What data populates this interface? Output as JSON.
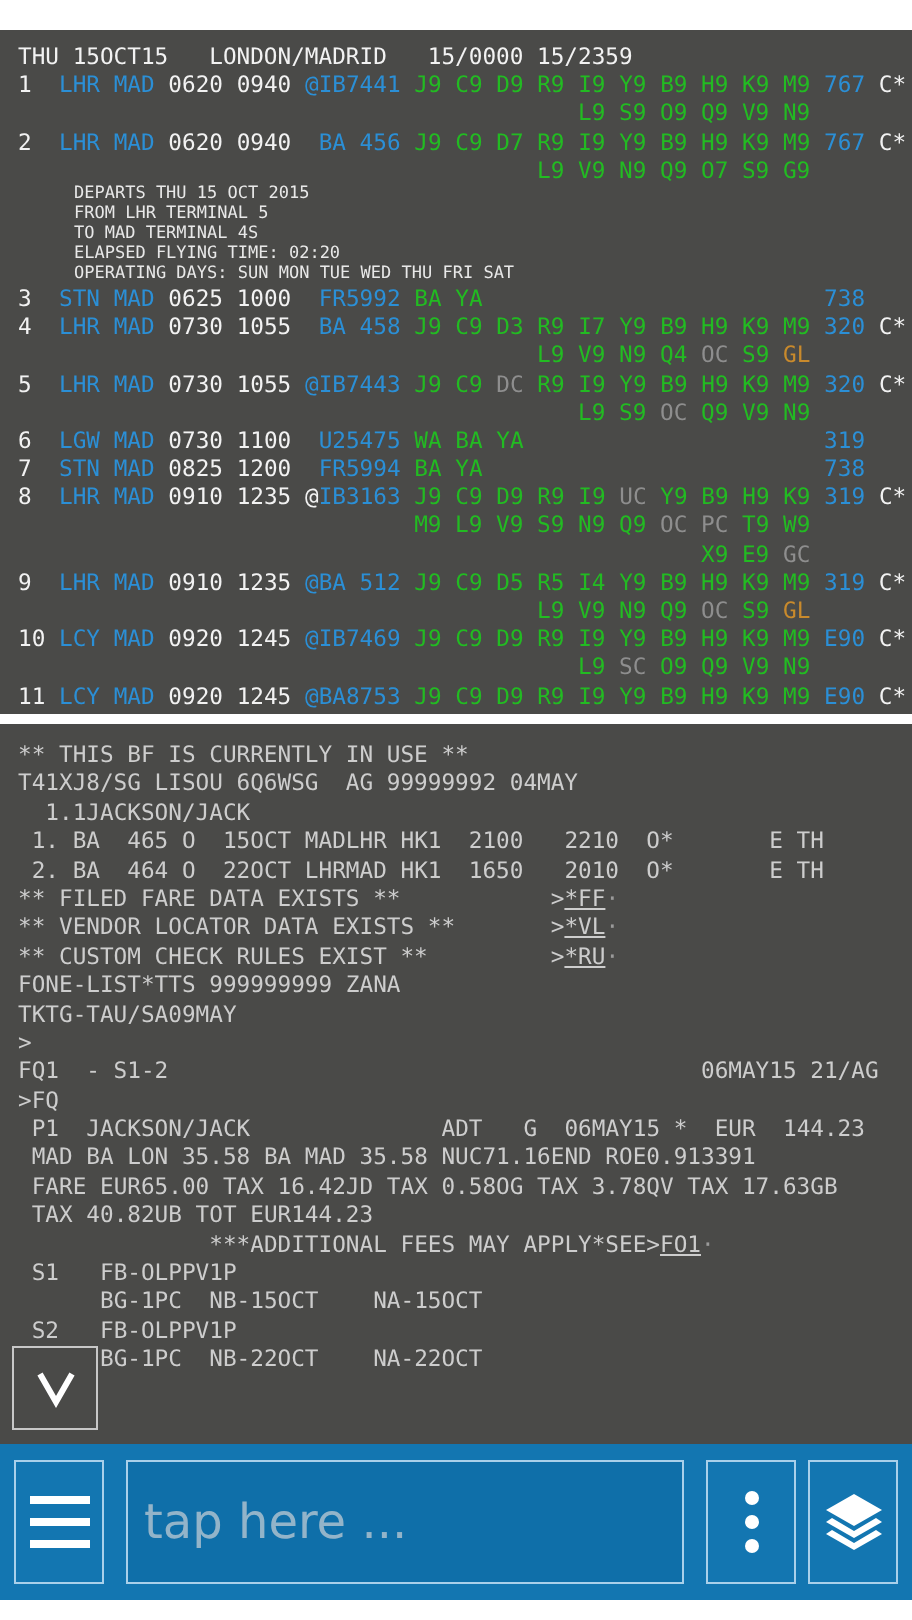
{
  "availability": {
    "header": "THU 15OCT15   LONDON/MADRID   15/0000 15/2359",
    "lines": [
      {
        "kind": "row",
        "segments": [
          {
            "text": "1",
            "kind": "plain"
          },
          {
            "text": "  LHR MAD",
            "kind": "route"
          },
          {
            "text": " 0620 0940",
            "kind": "plain"
          },
          {
            "text": " @IB7441",
            "kind": "route"
          },
          {
            "text": " J9 C9 D9 R9 I9 Y9 B9 H9 K9 M9",
            "kind": "open"
          },
          {
            "text": " 767",
            "kind": "route"
          },
          {
            "text": " C*",
            "kind": "plain"
          }
        ]
      },
      {
        "kind": "row",
        "segments": [
          {
            "text": "                                         L9 S9 O9 Q9 V9 N9",
            "kind": "open"
          }
        ]
      },
      {
        "kind": "row",
        "segments": [
          {
            "text": "2",
            "kind": "plain"
          },
          {
            "text": "  LHR MAD",
            "kind": "route"
          },
          {
            "text": " 0620 0940",
            "kind": "plain"
          },
          {
            "text": "  BA 456",
            "kind": "route"
          },
          {
            "text": " J9 C9 D7 R9 I9 Y9 B9 H9 K9 M9",
            "kind": "open"
          },
          {
            "text": " 767",
            "kind": "route"
          },
          {
            "text": " C*",
            "kind": "plain"
          }
        ]
      },
      {
        "kind": "row",
        "segments": [
          {
            "text": "                                      L9 V9 N9 Q9 O7 S9 G9",
            "kind": "open"
          }
        ]
      },
      {
        "kind": "note",
        "text": "DEPARTS THU 15 OCT 2015"
      },
      {
        "kind": "note",
        "text": "FROM LHR TERMINAL 5"
      },
      {
        "kind": "note",
        "text": "TO MAD TERMINAL 4S"
      },
      {
        "kind": "note",
        "text": "ELAPSED FLYING TIME: 02:20"
      },
      {
        "kind": "note",
        "text": "OPERATING DAYS: SUN MON TUE WED THU FRI SAT"
      },
      {
        "kind": "row",
        "segments": [
          {
            "text": "3",
            "kind": "plain"
          },
          {
            "text": "  STN MAD",
            "kind": "route"
          },
          {
            "text": " 0625 1000",
            "kind": "plain"
          },
          {
            "text": "  FR5992",
            "kind": "route"
          },
          {
            "text": " BA YA",
            "kind": "open"
          },
          {
            "text": "                         738",
            "kind": "route"
          }
        ]
      },
      {
        "kind": "row",
        "segments": [
          {
            "text": "4",
            "kind": "plain"
          },
          {
            "text": "  LHR MAD",
            "kind": "route"
          },
          {
            "text": " 0730 1055",
            "kind": "plain"
          },
          {
            "text": "  BA 458",
            "kind": "route"
          },
          {
            "text": " J9 C9 D3 R9 I7 Y9 B9 H9 K9 M9",
            "kind": "open"
          },
          {
            "text": " 320",
            "kind": "route"
          },
          {
            "text": " C*",
            "kind": "plain"
          }
        ]
      },
      {
        "kind": "row",
        "segments": [
          {
            "text": "                                      L9 V9 N9 Q4",
            "kind": "open"
          },
          {
            "text": " OC",
            "kind": "closed"
          },
          {
            "text": " S9",
            "kind": "open"
          },
          {
            "text": " GL",
            "kind": "limited"
          }
        ]
      },
      {
        "kind": "row",
        "segments": [
          {
            "text": "5",
            "kind": "plain"
          },
          {
            "text": "  LHR MAD",
            "kind": "route"
          },
          {
            "text": " 0730 1055",
            "kind": "plain"
          },
          {
            "text": " @IB7443",
            "kind": "route"
          },
          {
            "text": " J9 C9",
            "kind": "open"
          },
          {
            "text": " DC",
            "kind": "closed"
          },
          {
            "text": " R9 I9 Y9 B9 H9 K9 M9",
            "kind": "open"
          },
          {
            "text": " 320",
            "kind": "route"
          },
          {
            "text": " C*",
            "kind": "plain"
          }
        ]
      },
      {
        "kind": "row",
        "segments": [
          {
            "text": "                                         L9 S9",
            "kind": "open"
          },
          {
            "text": " OC",
            "kind": "closed"
          },
          {
            "text": " Q9 V9 N9",
            "kind": "open"
          }
        ]
      },
      {
        "kind": "row",
        "segments": [
          {
            "text": "6",
            "kind": "plain"
          },
          {
            "text": "  LGW MAD",
            "kind": "route"
          },
          {
            "text": " 0730 1100",
            "kind": "plain"
          },
          {
            "text": "  U25475",
            "kind": "route"
          },
          {
            "text": " WA BA YA",
            "kind": "open"
          },
          {
            "text": "                      319",
            "kind": "route"
          }
        ]
      },
      {
        "kind": "row",
        "segments": [
          {
            "text": "7",
            "kind": "plain"
          },
          {
            "text": "  STN MAD",
            "kind": "route"
          },
          {
            "text": " 0825 1200",
            "kind": "plain"
          },
          {
            "text": "  FR5994",
            "kind": "route"
          },
          {
            "text": " BA YA",
            "kind": "open"
          },
          {
            "text": "                         738",
            "kind": "route"
          }
        ]
      },
      {
        "kind": "row",
        "segments": [
          {
            "text": "8",
            "kind": "plain"
          },
          {
            "text": "  LHR MAD",
            "kind": "route"
          },
          {
            "text": " 0910 1235",
            "kind": "plain"
          },
          {
            "text": " @",
            "kind": "plain"
          },
          {
            "text": "IB3163",
            "kind": "route"
          },
          {
            "text": " J9 C9 D9 R9 I9",
            "kind": "open"
          },
          {
            "text": " UC",
            "kind": "closed"
          },
          {
            "text": " Y9 B9 H9 K9",
            "kind": "open"
          },
          {
            "text": " 319",
            "kind": "route"
          },
          {
            "text": " C*",
            "kind": "plain"
          }
        ]
      },
      {
        "kind": "row",
        "segments": [
          {
            "text": "                             M9 L9 V9 S9 N9 Q9",
            "kind": "open"
          },
          {
            "text": " OC PC",
            "kind": "closed"
          },
          {
            "text": " T9 W9",
            "kind": "open"
          }
        ]
      },
      {
        "kind": "row",
        "segments": [
          {
            "text": "                                                  X9 E9",
            "kind": "open"
          },
          {
            "text": " GC",
            "kind": "closed"
          }
        ]
      },
      {
        "kind": "row",
        "segments": [
          {
            "text": "9",
            "kind": "plain"
          },
          {
            "text": "  LHR MAD",
            "kind": "route"
          },
          {
            "text": " 0910 1235",
            "kind": "plain"
          },
          {
            "text": " @BA 512",
            "kind": "route"
          },
          {
            "text": " J9 C9 D5 R5 I4 Y9 B9 H9 K9 M9",
            "kind": "open"
          },
          {
            "text": " 319",
            "kind": "route"
          },
          {
            "text": " C*",
            "kind": "plain"
          }
        ]
      },
      {
        "kind": "row",
        "segments": [
          {
            "text": "                                      L9 V9 N9 Q9",
            "kind": "open"
          },
          {
            "text": " OC",
            "kind": "closed"
          },
          {
            "text": " S9",
            "kind": "open"
          },
          {
            "text": " GL",
            "kind": "limited"
          }
        ]
      },
      {
        "kind": "row",
        "segments": [
          {
            "text": "10",
            "kind": "plain"
          },
          {
            "text": " LCY MAD",
            "kind": "route"
          },
          {
            "text": " 0920 1245",
            "kind": "plain"
          },
          {
            "text": " @IB7469",
            "kind": "route"
          },
          {
            "text": " J9 C9 D9 R9 I9 Y9 B9 H9 K9 M9",
            "kind": "open"
          },
          {
            "text": " E90",
            "kind": "route"
          },
          {
            "text": " C*",
            "kind": "plain"
          }
        ]
      },
      {
        "kind": "row",
        "segments": [
          {
            "text": "                                         L9",
            "kind": "open"
          },
          {
            "text": " SC",
            "kind": "closed"
          },
          {
            "text": " O9 Q9 V9 N9",
            "kind": "open"
          }
        ]
      },
      {
        "kind": "row",
        "segments": [
          {
            "text": "11",
            "kind": "plain"
          },
          {
            "text": " LCY MAD",
            "kind": "route"
          },
          {
            "text": " 0920 1245",
            "kind": "plain"
          },
          {
            "text": " @BA8753",
            "kind": "route"
          },
          {
            "text": " J9 C9 D9 R9 I9 Y9 B9 H9 K9 M9",
            "kind": "open"
          },
          {
            "text": " E90",
            "kind": "route"
          },
          {
            "text": " C*",
            "kind": "plain"
          }
        ]
      }
    ]
  },
  "booking": {
    "lines": [
      [
        {
          "text": "** THIS BF IS CURRENTLY IN USE **",
          "kind": "plain"
        }
      ],
      [
        {
          "text": "T41XJ8/SG LISOU 6Q6WSG  AG 99999992 04MAY",
          "kind": "plain"
        }
      ],
      [
        {
          "text": "  1.1JACKSON/JACK",
          "kind": "plain"
        }
      ],
      [
        {
          "text": " 1. BA  465 O  15OCT MADLHR HK1  2100   2210  O*       E TH",
          "kind": "plain"
        }
      ],
      [
        {
          "text": " 2. BA  464 O  22OCT LHRMAD HK1  1650   2010  O*       E TH",
          "kind": "plain"
        }
      ],
      [
        {
          "text": "** FILED FARE DATA EXISTS **",
          "kind": "plain"
        },
        {
          "text": "           >",
          "kind": "plain"
        },
        {
          "text": "*FF",
          "kind": "link"
        },
        {
          "text": "·",
          "kind": "marker"
        }
      ],
      [
        {
          "text": "** VENDOR LOCATOR DATA EXISTS **",
          "kind": "plain"
        },
        {
          "text": "       >",
          "kind": "plain"
        },
        {
          "text": "*VL",
          "kind": "link"
        },
        {
          "text": "·",
          "kind": "marker"
        }
      ],
      [
        {
          "text": "** CUSTOM CHECK RULES EXIST **",
          "kind": "plain"
        },
        {
          "text": "         >",
          "kind": "plain"
        },
        {
          "text": "*RU",
          "kind": "link"
        },
        {
          "text": "·",
          "kind": "marker"
        }
      ],
      [
        {
          "text": "FONE-LIST*TTS 999999999 ZANA",
          "kind": "plain"
        }
      ],
      [
        {
          "text": "TKTG-TAU/SA09MAY",
          "kind": "plain"
        }
      ],
      [
        {
          "text": ">",
          "kind": "plain"
        }
      ],
      [
        {
          "text": "FQ1  - S1-2",
          "kind": "plain"
        },
        {
          "text": "                                       06MAY15 21/AG",
          "kind": "plain"
        }
      ],
      [
        {
          "text": ">FQ",
          "kind": "plain"
        }
      ],
      [
        {
          "text": " P1  JACKSON/JACK",
          "kind": "plain"
        },
        {
          "text": "              ADT   G  06MAY15 *  EUR  144.23",
          "kind": "plain"
        }
      ],
      [
        {
          "text": " MAD BA LON 35.58 BA MAD 35.58 NUC71.16END ROE0.913391",
          "kind": "plain"
        }
      ],
      [
        {
          "text": " FARE EUR65.00 TAX 16.42JD TAX 0.58OG TAX 3.78QV TAX 17.63GB",
          "kind": "plain"
        }
      ],
      [
        {
          "text": " TAX 40.82UB TOT EUR144.23",
          "kind": "plain"
        }
      ],
      [
        {
          "text": "              ***ADDITIONAL FEES MAY APPLY*SEE>",
          "kind": "plain"
        },
        {
          "text": "FO1",
          "kind": "link"
        },
        {
          "text": "·",
          "kind": "marker"
        }
      ],
      [
        {
          "text": " S1   FB-OLPPV1P",
          "kind": "plain"
        }
      ],
      [
        {
          "text": "      BG-1PC  NB-15OCT    NA-15OCT",
          "kind": "plain"
        }
      ],
      [
        {
          "text": " S2   FB-OLPPV1P",
          "kind": "plain"
        }
      ],
      [
        {
          "text": "      BG-1PC  NB-22OCT    NA-22OCT",
          "kind": "plain"
        }
      ]
    ]
  },
  "toolbar": {
    "input": {
      "placeholder": "tap here ..."
    }
  }
}
